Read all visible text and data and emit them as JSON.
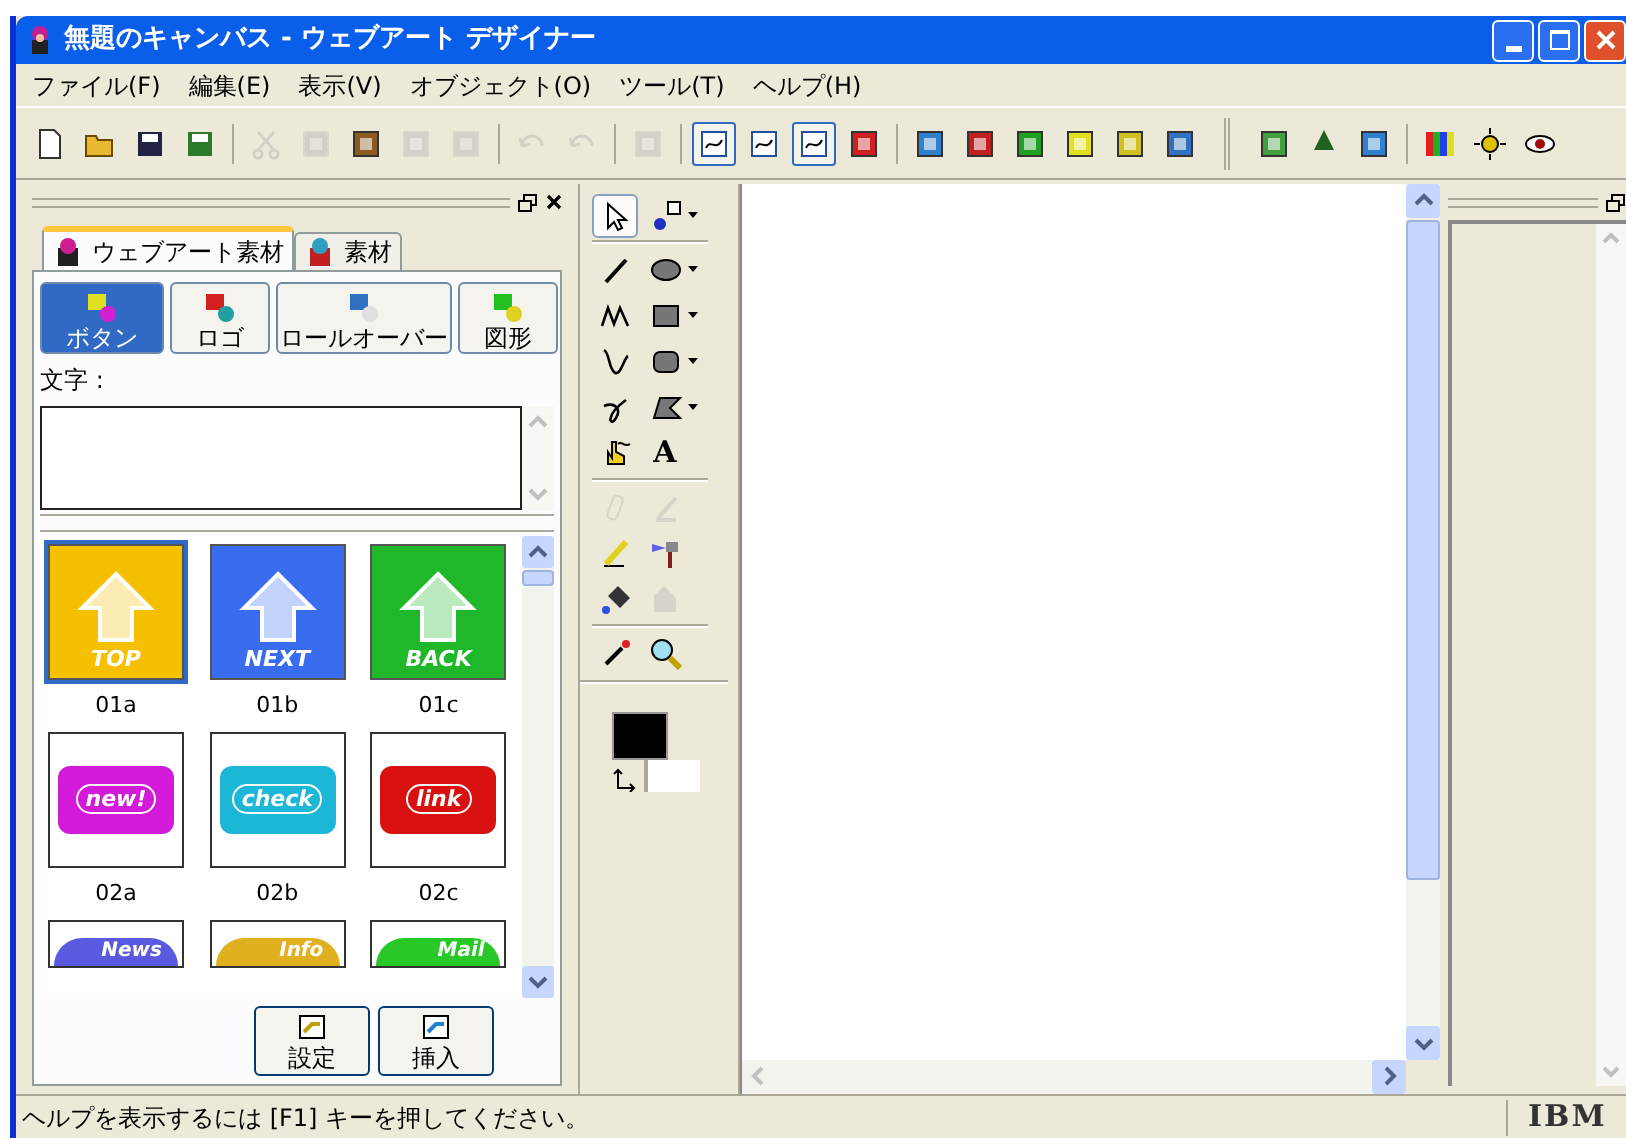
{
  "window": {
    "title": "無題のキャンバス - ウェブアート デザイナー"
  },
  "menu": [
    "ファイル(F)",
    "編集(E)",
    "表示(V)",
    "オブジェクト(O)",
    "ツール(T)",
    "ヘルプ(H)"
  ],
  "toolbar": [
    {
      "kind": "button",
      "disabled": false,
      "pressed": false
    },
    {
      "kind": "button",
      "disabled": false,
      "pressed": false
    },
    {
      "kind": "button",
      "disabled": false,
      "pressed": false
    },
    {
      "kind": "button",
      "disabled": false,
      "pressed": false
    },
    {
      "kind": "separator"
    },
    {
      "kind": "button",
      "disabled": true,
      "pressed": false
    },
    {
      "kind": "button",
      "disabled": true,
      "pressed": false
    },
    {
      "kind": "button",
      "disabled": false,
      "pressed": false
    },
    {
      "kind": "button",
      "disabled": true,
      "pressed": false
    },
    {
      "kind": "button",
      "disabled": true,
      "pressed": false
    },
    {
      "kind": "separator"
    },
    {
      "kind": "button",
      "disabled": true,
      "pressed": false
    },
    {
      "kind": "button",
      "disabled": true,
      "pressed": false
    },
    {
      "kind": "separator"
    },
    {
      "kind": "button",
      "disabled": true,
      "pressed": false
    },
    {
      "kind": "separator"
    },
    {
      "kind": "button",
      "disabled": false,
      "pressed": true
    },
    {
      "kind": "button",
      "disabled": false,
      "pressed": false
    },
    {
      "kind": "button",
      "disabled": false,
      "pressed": true
    },
    {
      "kind": "button",
      "disabled": false,
      "pressed": false
    },
    {
      "kind": "separator"
    },
    {
      "kind": "button",
      "disabled": false,
      "pressed": false
    },
    {
      "kind": "button",
      "disabled": false,
      "pressed": false
    },
    {
      "kind": "button",
      "disabled": false,
      "pressed": false
    },
    {
      "kind": "button",
      "disabled": false,
      "pressed": false
    },
    {
      "kind": "button",
      "disabled": false,
      "pressed": false
    },
    {
      "kind": "button",
      "disabled": false,
      "pressed": false
    },
    {
      "kind": "grip"
    },
    {
      "kind": "button",
      "disabled": false,
      "pressed": false
    },
    {
      "kind": "button",
      "disabled": false,
      "pressed": false
    },
    {
      "kind": "button",
      "disabled": false,
      "pressed": false
    },
    {
      "kind": "separator"
    },
    {
      "kind": "button",
      "disabled": false,
      "pressed": false
    },
    {
      "kind": "button",
      "disabled": false,
      "pressed": false
    },
    {
      "kind": "button",
      "disabled": false,
      "pressed": false
    }
  ],
  "left_panel": {
    "tabs": [
      {
        "label": "ウェブアート素材",
        "selected": true
      },
      {
        "label": "素材",
        "selected": false
      }
    ],
    "categories": [
      {
        "label": "ボタン",
        "selected": true
      },
      {
        "label": "ロゴ",
        "selected": false
      },
      {
        "label": "ロールオーバー",
        "selected": false
      },
      {
        "label": "図形",
        "selected": false
      }
    ],
    "text_label": "文字 :",
    "gallery": [
      {
        "kind": "arrow",
        "art": "TOP",
        "label": "01a",
        "color": "#f5c000",
        "selected": true
      },
      {
        "kind": "arrow",
        "art": "NEXT",
        "label": "01b",
        "color": "#3a6cf0",
        "selected": false
      },
      {
        "kind": "arrow",
        "art": "BACK",
        "label": "01c",
        "color": "#1fb82a",
        "selected": false
      },
      {
        "kind": "shirt",
        "art": "new!",
        "label": "02a",
        "color": "#d21ad8",
        "selected": false
      },
      {
        "kind": "shirt",
        "art": "check",
        "label": "02b",
        "color": "#1cb6d6",
        "selected": false
      },
      {
        "kind": "shirt",
        "art": "link",
        "label": "02c",
        "color": "#d81010",
        "selected": false
      },
      {
        "kind": "pill",
        "art": "News",
        "color": "#5a5ae0",
        "selected": false
      },
      {
        "kind": "pill",
        "art": "Info",
        "color": "#e0b020",
        "selected": false
      },
      {
        "kind": "pill",
        "art": "Mail",
        "color": "#28c828",
        "selected": false
      }
    ],
    "actions": [
      "設定",
      "挿入"
    ]
  },
  "tools": [
    [
      {
        "selected": true,
        "disabled": false,
        "dropdown": false
      },
      {
        "selected": false,
        "disabled": false,
        "dropdown": true
      }
    ],
    [
      {
        "selected": false,
        "disabled": false,
        "dropdown": false
      },
      {
        "selected": false,
        "disabled": false,
        "dropdown": true
      }
    ],
    [
      {
        "selected": false,
        "disabled": false,
        "dropdown": false
      },
      {
        "selected": false,
        "disabled": false,
        "dropdown": true
      }
    ],
    [
      {
        "selected": false,
        "disabled": false,
        "dropdown": false
      },
      {
        "selected": false,
        "disabled": false,
        "dropdown": true
      }
    ],
    [
      {
        "selected": false,
        "disabled": false,
        "dropdown": false
      },
      {
        "selected": false,
        "disabled": false,
        "dropdown": true
      }
    ],
    [
      {
        "selected": false,
        "disabled": false,
        "dropdown": false
      },
      {
        "selected": false,
        "disabled": false,
        "dropdown": false,
        "glyph": "A"
      }
    ],
    [
      {
        "selected": false,
        "disabled": true,
        "dropdown": false
      },
      {
        "selected": false,
        "disabled": true,
        "dropdown": false
      }
    ],
    [
      {
        "selected": false,
        "disabled": false,
        "dropdown": false
      },
      {
        "selected": false,
        "disabled": false,
        "dropdown": false
      }
    ],
    [
      {
        "selected": false,
        "disabled": false,
        "dropdown": false
      },
      {
        "selected": false,
        "disabled": true,
        "dropdown": false
      }
    ],
    [
      {
        "selected": false,
        "disabled": false,
        "dropdown": false
      },
      {
        "selected": false,
        "disabled": false,
        "dropdown": false
      }
    ]
  ],
  "status_bar": {
    "text": "ヘルプを表示するには [F1] キーを押してください。",
    "logo": "IBM"
  }
}
